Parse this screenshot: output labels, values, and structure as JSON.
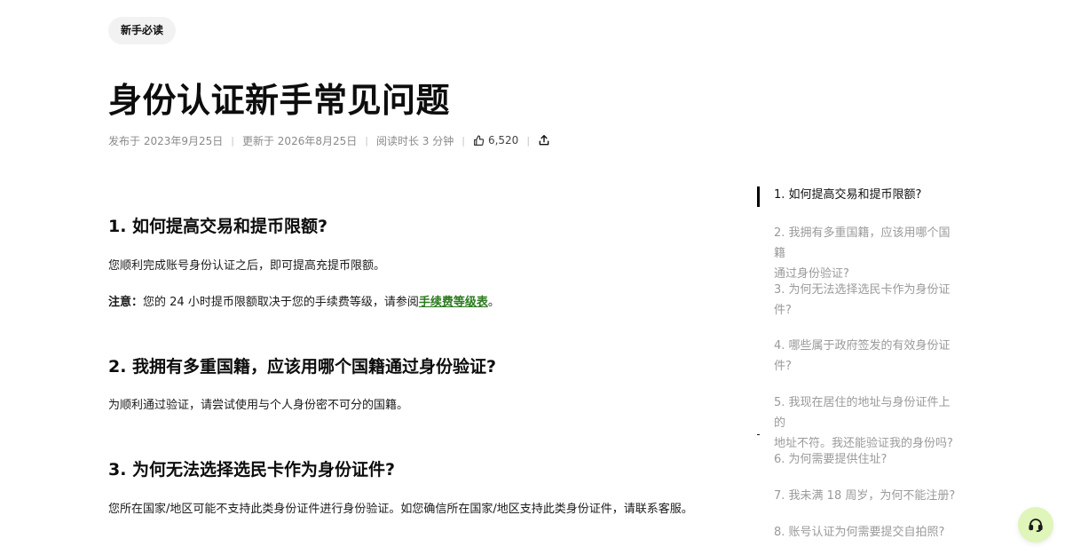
{
  "tag": "新手必读",
  "title": "身份认证新手常见问题",
  "meta": {
    "published": "发布于 2023年9月25日",
    "updated": "更新于 2026年8月25日",
    "read_time": "阅读时长 3 分钟",
    "likes": "6,520",
    "sep": "|"
  },
  "sections": [
    {
      "heading": "1. 如何提高交易和提币限额?",
      "para1": "您顺利完成账号身份认证之后，即可提高充提币限额。",
      "note_label": "注意：",
      "note_text": "您的 24 小时提币限额取决于您的手续费等级，请参阅",
      "note_link": "手续费等级表",
      "note_end": "。"
    },
    {
      "heading": "2. 我拥有多重国籍，应该用哪个国籍通过身份验证?",
      "para1": "为顺利通过验证，请尝试使用与个人身份密不可分的国籍。"
    },
    {
      "heading": "3. 为何无法选择选民卡作为身份证件?",
      "para1": "您所在国家/地区可能不支持此类身份证件进行身份验证。如您确信所在国家/地区支持此类身份证件，请联系客服。"
    }
  ],
  "toc": [
    {
      "l1": "1. 如何提高交易和提币限额?",
      "l2": ""
    },
    {
      "l1": "2. 我拥有多重国籍，应该用哪个国籍",
      "l2": "通过身份验证?"
    },
    {
      "l1": "3. 为何无法选择选民卡作为身份证",
      "l2": "件?"
    },
    {
      "l1": "4. 哪些属于政府签发的有效身份证",
      "l2": "件?"
    },
    {
      "l1": "5. 我现在居住的地址与身份证件上的",
      "l2": "地址不符。我还能验证我的身份吗?"
    },
    {
      "l1": "6. 为何需要提供住址?",
      "l2": ""
    },
    {
      "l1": "7. 我未满 18 周岁，为何不能注册?",
      "l2": ""
    },
    {
      "l1": "8. 账号认证为何需要提交自拍照?",
      "l2": ""
    }
  ],
  "icons": {
    "like": "thumbs-up-icon",
    "share": "share-icon",
    "support": "headset-icon"
  },
  "colors": {
    "link": "#2b7a1f",
    "support_bg": "#dff5b9"
  }
}
